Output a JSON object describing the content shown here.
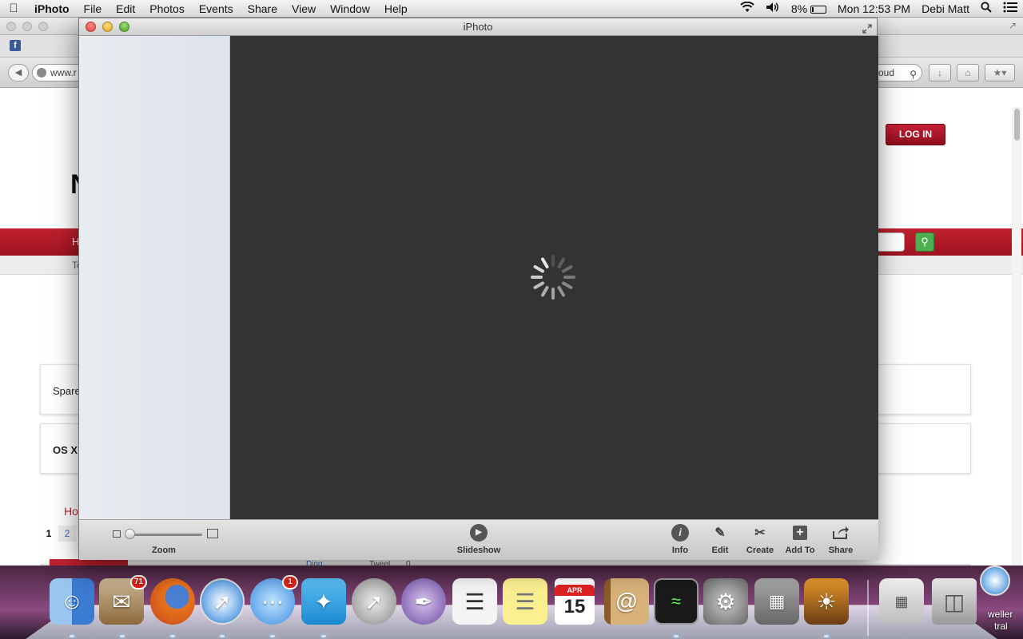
{
  "menubar": {
    "apple": "",
    "app_name": "iPhoto",
    "items": [
      "File",
      "Edit",
      "Photos",
      "Events",
      "Share",
      "View",
      "Window",
      "Help"
    ],
    "battery": "8%",
    "clock": "Mon 12:53 PM",
    "user": "Debi Matt"
  },
  "browser": {
    "url_fragment": "www.r",
    "search_fragment": "oud",
    "login": "LOG IN",
    "big_letter": "N",
    "nav_fragment": "H",
    "sub_fragment": "To",
    "card1": "Spare",
    "card2": "OS X",
    "home_fragment": "Ho",
    "pages": [
      "1",
      "2"
    ],
    "digg": "Digg",
    "tweet": "Tweet",
    "tweet_count": "0"
  },
  "iphoto": {
    "title": "iPhoto",
    "zoom_label": "Zoom",
    "slideshow_label": "Slideshow",
    "tools": {
      "info": "Info",
      "edit": "Edit",
      "create": "Create",
      "add_to": "Add To",
      "share": "Share"
    }
  },
  "dock": {
    "mail_badge": "71",
    "messages_badge": "1",
    "calendar_month": "APR",
    "calendar_day": "15",
    "right_text_1": "weller",
    "right_text_2": "tral"
  },
  "colors": {
    "accent_red": "#c0212f",
    "iphoto_canvas": "#333333"
  }
}
